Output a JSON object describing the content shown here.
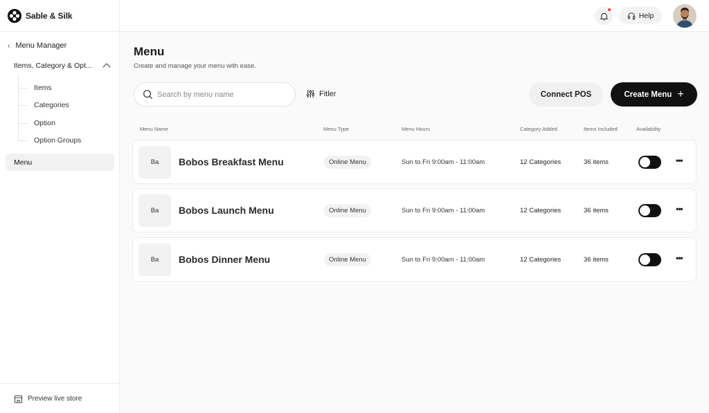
{
  "brand": {
    "name": "Sable & Silk"
  },
  "sidebar": {
    "back_label": "Menu Manager",
    "section_label": "Items, Category & Opt...",
    "sub_items": [
      "Items",
      "Categories",
      "Option",
      "Option Groups"
    ],
    "active_item": "Menu",
    "footer_label": "Preview live store"
  },
  "topbar": {
    "help_label": "Help",
    "notification_color": "#e53935"
  },
  "main": {
    "title": "Menu",
    "subtitle": "Create and manage your menu with ease.",
    "search_placeholder": "Search by menu name",
    "filter_label": "Fitler",
    "connect_pos_label": "Connect POS",
    "create_menu_label": "Create Menu",
    "columns": [
      "Menu Name",
      "Menu Type",
      "Menu Hours",
      "Category Added",
      "Items Included",
      "Availability"
    ],
    "rows": [
      {
        "thumb": "Ba",
        "name": "Bobos Breakfast Menu",
        "type": "Online Menu",
        "hours": "Sun to Fri 9:00am - 11:00am",
        "categories": "12 Categories",
        "items": "36 items",
        "available": false
      },
      {
        "thumb": "Ba",
        "name": "Bobos Launch Menu",
        "type": "Online Menu",
        "hours": "Sun to Fri 9:00am - 11:00am",
        "categories": "12 Categories",
        "items": "36 items",
        "available": false
      },
      {
        "thumb": "Ba",
        "name": "Bobos Dinner Menu",
        "type": "Online Menu",
        "hours": "Sun to Fri 9:00am - 11:00am",
        "categories": "12 Categories",
        "items": "36 items",
        "available": false
      }
    ]
  },
  "icons": {
    "brand": "brand-logo-icon",
    "back": "chevron-left-icon",
    "collapse": "chevron-up-icon",
    "store": "store-icon",
    "bell": "bell-icon",
    "help": "headset-icon",
    "search": "search-icon",
    "filter": "sliders-icon",
    "plus": "plus-icon",
    "more": "more-horizontal-icon"
  }
}
